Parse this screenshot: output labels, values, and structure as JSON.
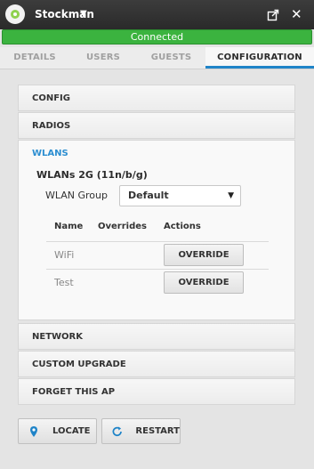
{
  "titlebar": {
    "ap_name": "Stockman",
    "caret": "▼",
    "close": "✕"
  },
  "status": {
    "text": "Connected",
    "color": "#3bb33f"
  },
  "tabs": [
    {
      "label": "DETAILS"
    },
    {
      "label": "USERS"
    },
    {
      "label": "GUESTS"
    },
    {
      "label": "CONFIGURATION"
    }
  ],
  "active_tab": "CONFIGURATION",
  "accent_color": "#1f84c8",
  "sections": {
    "config": "CONFIG",
    "radios": "RADIOS",
    "wlans": "WLANS",
    "network": "NETWORK",
    "custom_upgrade": "CUSTOM UPGRADE",
    "forget": "FORGET THIS AP"
  },
  "wlans": {
    "subtitle": "WLANs 2G (11n/b/g)",
    "group_label": "WLAN Group",
    "group_value": "Default",
    "columns": {
      "name": "Name",
      "overrides": "Overrides",
      "actions": "Actions"
    },
    "rows": [
      {
        "name": "WiFi",
        "action": "OVERRIDE"
      },
      {
        "name": "Test",
        "action": "OVERRIDE"
      }
    ]
  },
  "buttons": {
    "locate": "LOCATE",
    "restart": "RESTART"
  },
  "icons": {
    "logo": "unifi-logo-icon",
    "popout": "popout-icon",
    "close": "close-icon",
    "locate": "map-pin-icon",
    "restart": "refresh-icon"
  }
}
